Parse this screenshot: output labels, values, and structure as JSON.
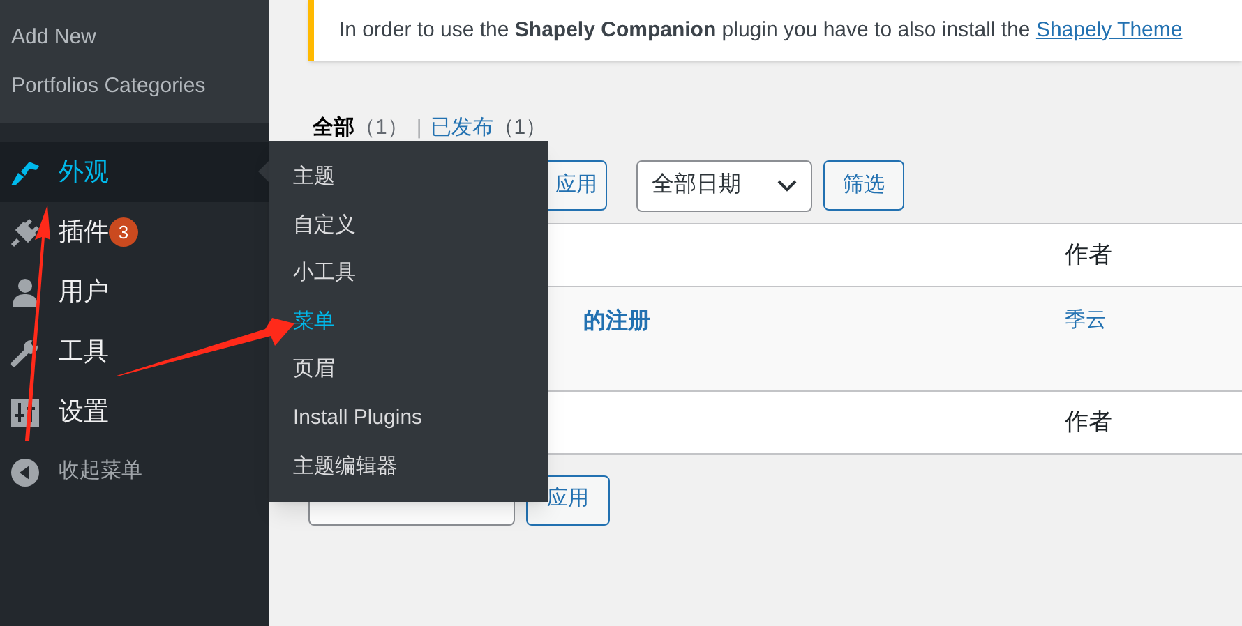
{
  "sidebar": {
    "submenu": [
      "Add New",
      "Portfolios Categories"
    ],
    "items": [
      {
        "label": "外观",
        "selected": true
      },
      {
        "label": "插件",
        "selected": false,
        "badge": "3"
      },
      {
        "label": "用户",
        "selected": false
      },
      {
        "label": "工具",
        "selected": false
      },
      {
        "label": "设置",
        "selected": false
      },
      {
        "label": "收起菜单",
        "selected": false,
        "kind": "collapse"
      }
    ]
  },
  "flyout": {
    "items": [
      {
        "label": "主题",
        "selected": false
      },
      {
        "label": "自定义",
        "selected": false
      },
      {
        "label": "小工具",
        "selected": false
      },
      {
        "label": "菜单",
        "selected": true
      },
      {
        "label": "页眉",
        "selected": false
      },
      {
        "label": "Install Plugins",
        "selected": false
      },
      {
        "label": "主题编辑器",
        "selected": false
      }
    ]
  },
  "notice": {
    "text": "In order to use the **Shapely Companion** plugin you have to also install the",
    "link": "Shapely Theme"
  },
  "status_links": {
    "separator": "|",
    "items": [
      {
        "label": "全部",
        "count": "（1）",
        "selected": true
      },
      {
        "label": "已发布",
        "count": "（1）",
        "selected": false
      }
    ]
  },
  "top_actions": {
    "apply": "应用",
    "date_filter": "全部日期",
    "filter": "筛选"
  },
  "table": {
    "header": [
      "作者"
    ],
    "rows": [
      {
        "title": "的注册",
        "author": "季云"
      }
    ],
    "footer": [
      "作者"
    ]
  },
  "bottom_actions": {
    "apply": "应用"
  }
}
